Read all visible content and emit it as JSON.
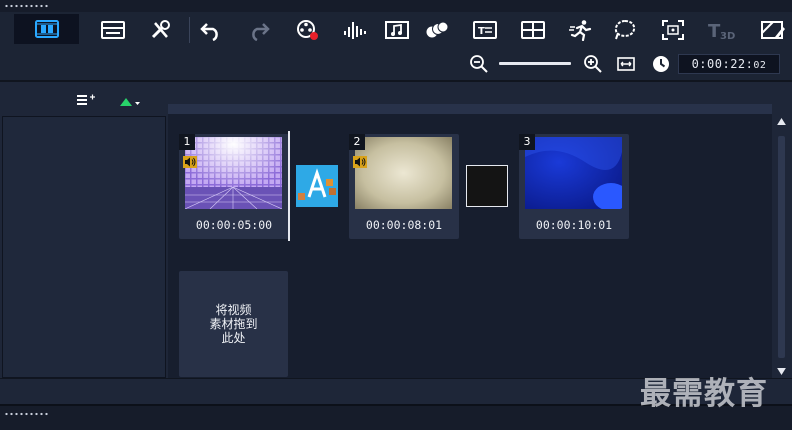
{
  "toolbar": {
    "items": [
      "storyboard-view",
      "timeline-view",
      "tools",
      "undo",
      "redo",
      "record-capture",
      "sound-mixer",
      "auto-music",
      "motion-tracking",
      "subtitle-editor",
      "multi-camera-editor",
      "time-remapping",
      "mask-creator",
      "pan-and-zoom",
      "3d-title-editor",
      "split-screen-template"
    ],
    "title_3d_label": "T3D"
  },
  "zoom": {
    "timecode_main": "0:00:22:",
    "timecode_frames": "02"
  },
  "clips": [
    {
      "number": "1",
      "duration": "00:00:05:00",
      "has_audio": true
    },
    {
      "number": "2",
      "duration": "00:00:08:01",
      "has_audio": true
    },
    {
      "number": "3",
      "duration": "00:00:10:01",
      "has_audio": false
    }
  ],
  "drop_zone": {
    "text": "将视频\n素材拖到\n此处"
  },
  "watermark": {
    "text": "最需教育"
  },
  "colors": {
    "accent": "#2aa8ff",
    "record_red": "#e8202a",
    "green_arrow": "#28d36a"
  }
}
